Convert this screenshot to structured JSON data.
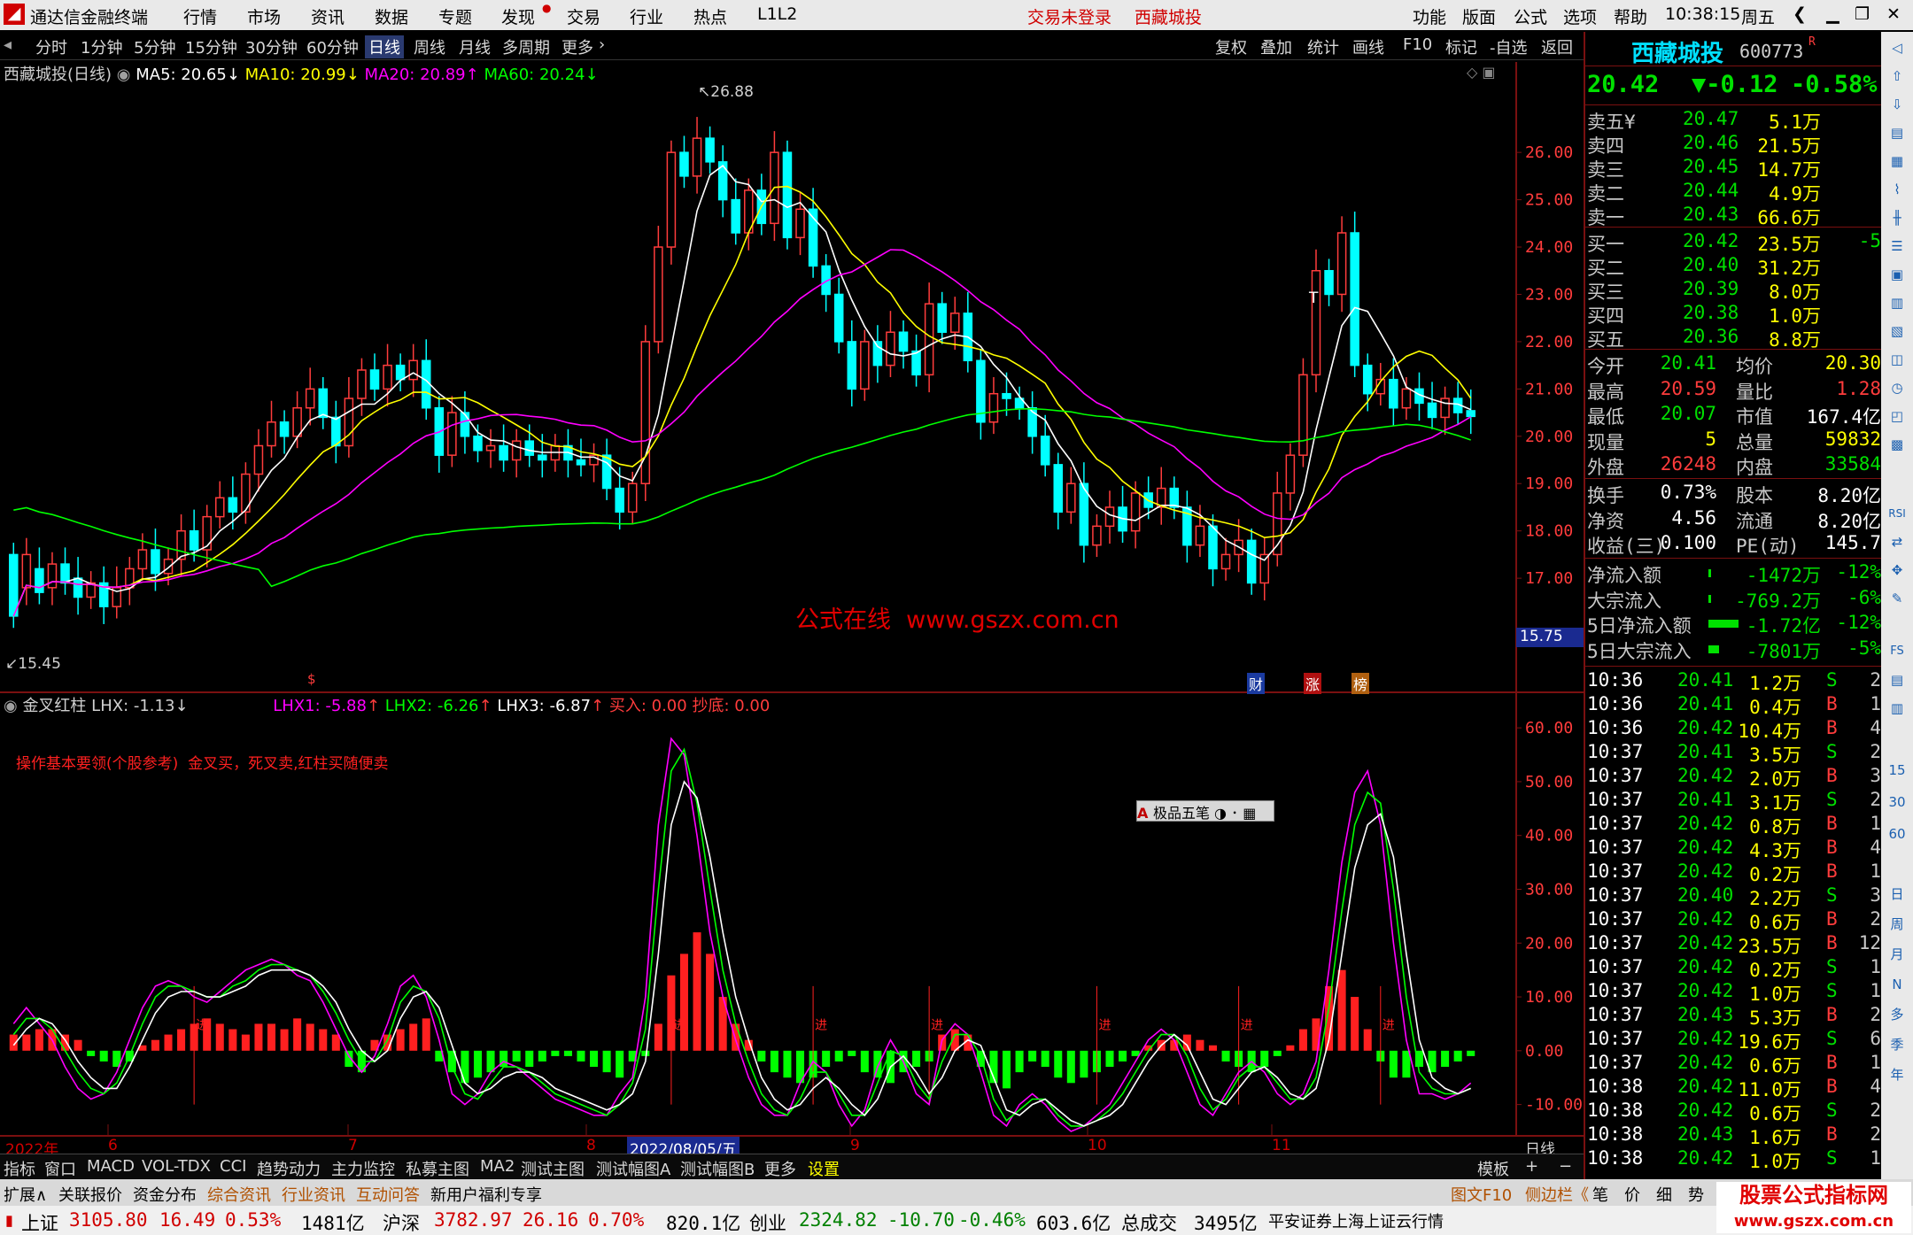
{
  "titlebar": {
    "app_name": "通达信金融终端",
    "menus": [
      "行情",
      "市场",
      "资讯",
      "数据",
      "专题",
      "发现",
      "交易",
      "行业",
      "热点",
      "L1L2"
    ],
    "login_status": "交易未登录",
    "stock_name": "西藏城投",
    "right_menus": [
      "功能",
      "版面",
      "公式",
      "选项",
      "帮助"
    ],
    "time": "10:38:15",
    "weekday": "周五"
  },
  "periodbar": {
    "periods": [
      "分时",
      "1分钟",
      "5分钟",
      "15分钟",
      "30分钟",
      "60分钟",
      "日线",
      "周线",
      "月线",
      "多周期",
      "更多"
    ],
    "selected": "日线",
    "tools": [
      "复权",
      "叠加",
      "统计",
      "画线",
      "F10",
      "标记",
      "-自选",
      "返回"
    ]
  },
  "main_chart": {
    "header_name": "西藏城投(日线)",
    "ma5": "MA5: 20.65",
    "ma10": "MA10: 20.99",
    "ma20": "MA20: 20.89",
    "ma60": "MA60: 20.24",
    "high_label": "26.88",
    "low_label": "15.45",
    "t_mark": "T",
    "watermark": "公式在线  www.gszx.com.cn",
    "price_ticks": [
      "26.00",
      "25.00",
      "24.00",
      "23.00",
      "22.00",
      "21.00",
      "20.00",
      "19.00",
      "18.00",
      "17.00"
    ],
    "cursor_price": "15.75",
    "markers": [
      "财",
      "涨",
      "榜"
    ],
    "dollar_mark": "$",
    "colors": {
      "up": "#ff3c3c",
      "down": "#00ffff",
      "ma5": "#ffffff",
      "ma10": "#ffff00",
      "ma20": "#ff00ff",
      "ma60": "#00ff00"
    }
  },
  "sub_chart": {
    "name": "金叉红柱",
    "lhx": "LHX: -1.13",
    "lhx1": "LHX1: -5.88",
    "lhx2": "LHX2: -6.26",
    "lhx3": "LHX3: -6.87",
    "buy": "买入: 0.00",
    "bottom": "抄底: 0.00",
    "note": "操作基本要领(个股参考)  金叉买，死叉卖,红柱买随便卖",
    "ticks": [
      "60.00",
      "50.00",
      "40.00",
      "30.00",
      "20.00",
      "10.00",
      "0.00",
      "-10.00"
    ],
    "jin": "进",
    "ime": "极品五笔"
  },
  "date_axis": {
    "labels": [
      "2022年",
      "6",
      "7",
      "8",
      "2022/08/05/五",
      "9",
      "10",
      "11"
    ],
    "period": "日线"
  },
  "quote": {
    "name": "西藏城投",
    "code": "600773",
    "r_mark": "R",
    "price": "20.42",
    "change": "▼-0.12",
    "change_pct": "-0.58%",
    "asks": [
      {
        "label": "卖五",
        "price": "20.47",
        "vol": "5.1万",
        "mark": "¥"
      },
      {
        "label": "卖四",
        "price": "20.46",
        "vol": "21.5万",
        "mark": ""
      },
      {
        "label": "卖三",
        "price": "20.45",
        "vol": "14.7万",
        "mark": ""
      },
      {
        "label": "卖二",
        "price": "20.44",
        "vol": "4.9万",
        "mark": ""
      },
      {
        "label": "卖一",
        "price": "20.43",
        "vol": "66.6万",
        "mark": ""
      }
    ],
    "bids": [
      {
        "label": "买一",
        "price": "20.42",
        "vol": "23.5万",
        "mark": "-5"
      },
      {
        "label": "买二",
        "price": "20.40",
        "vol": "31.2万",
        "mark": ""
      },
      {
        "label": "买三",
        "price": "20.39",
        "vol": "8.0万",
        "mark": ""
      },
      {
        "label": "买四",
        "price": "20.38",
        "vol": "1.0万",
        "mark": ""
      },
      {
        "label": "买五",
        "price": "20.36",
        "vol": "8.8万",
        "mark": ""
      }
    ],
    "stats": [
      {
        "l1": "今开",
        "v1": "20.41",
        "l2": "均价",
        "v2": "20.30"
      },
      {
        "l1": "最高",
        "v1": "20.59",
        "l2": "量比",
        "v2": "1.28"
      },
      {
        "l1": "最低",
        "v1": "20.07",
        "l2": "市值",
        "v2": "167.4亿"
      },
      {
        "l1": "现量",
        "v1": "5",
        "l2": "总量",
        "v2": "59832"
      },
      {
        "l1": "外盘",
        "v1": "26248",
        "l2": "内盘",
        "v2": "33584"
      }
    ],
    "stats2": [
      {
        "l1": "换手",
        "v1": "0.73%",
        "l2": "股本",
        "v2": "8.20亿"
      },
      {
        "l1": "净资",
        "v1": "4.56",
        "l2": "流通",
        "v2": "8.20亿"
      },
      {
        "l1": "收益(三)",
        "v1": "0.100",
        "l2": "PE(动)",
        "v2": "145.7"
      }
    ],
    "flows": [
      {
        "label": "净流入额",
        "val": "-1472万",
        "pct": "-12%"
      },
      {
        "label": "大宗流入",
        "val": "-769.2万",
        "pct": "-6%"
      },
      {
        "label": "5日净流入额",
        "val": "-1.72亿",
        "pct": "-12%"
      },
      {
        "label": "5日大宗流入",
        "val": "-7801万",
        "pct": "-5%"
      }
    ],
    "ticks": [
      {
        "t": "10:36",
        "p": "20.41",
        "v": "1.2万",
        "s": "S",
        "n": "2"
      },
      {
        "t": "10:36",
        "p": "20.41",
        "v": "0.4万",
        "s": "B",
        "n": "1"
      },
      {
        "t": "10:36",
        "p": "20.42",
        "v": "10.4万",
        "s": "B",
        "n": "4"
      },
      {
        "t": "10:37",
        "p": "20.41",
        "v": "3.5万",
        "s": "S",
        "n": "2"
      },
      {
        "t": "10:37",
        "p": "20.42",
        "v": "2.0万",
        "s": "B",
        "n": "3"
      },
      {
        "t": "10:37",
        "p": "20.41",
        "v": "3.1万",
        "s": "S",
        "n": "2"
      },
      {
        "t": "10:37",
        "p": "20.42",
        "v": "0.8万",
        "s": "B",
        "n": "1"
      },
      {
        "t": "10:37",
        "p": "20.42",
        "v": "4.3万",
        "s": "B",
        "n": "4"
      },
      {
        "t": "10:37",
        "p": "20.42",
        "v": "0.2万",
        "s": "B",
        "n": "1"
      },
      {
        "t": "10:37",
        "p": "20.40",
        "v": "2.2万",
        "s": "S",
        "n": "3"
      },
      {
        "t": "10:37",
        "p": "20.42",
        "v": "0.6万",
        "s": "B",
        "n": "2"
      },
      {
        "t": "10:37",
        "p": "20.42",
        "v": "23.5万",
        "s": "B",
        "n": "12"
      },
      {
        "t": "10:37",
        "p": "20.42",
        "v": "0.2万",
        "s": "S",
        "n": "1"
      },
      {
        "t": "10:37",
        "p": "20.42",
        "v": "1.0万",
        "s": "S",
        "n": "1"
      },
      {
        "t": "10:37",
        "p": "20.43",
        "v": "5.3万",
        "s": "B",
        "n": "2"
      },
      {
        "t": "10:37",
        "p": "20.42",
        "v": "19.6万",
        "s": "S",
        "n": "6"
      },
      {
        "t": "10:37",
        "p": "20.42",
        "v": "0.6万",
        "s": "B",
        "n": "1"
      },
      {
        "t": "10:38",
        "p": "20.42",
        "v": "11.0万",
        "s": "B",
        "n": "4"
      },
      {
        "t": "10:38",
        "p": "20.42",
        "v": "0.6万",
        "s": "S",
        "n": "2"
      },
      {
        "t": "10:38",
        "p": "20.43",
        "v": "1.6万",
        "s": "B",
        "n": "2"
      },
      {
        "t": "10:38",
        "p": "20.42",
        "v": "1.0万",
        "s": "S",
        "n": "1"
      }
    ]
  },
  "right_icons": [
    "RSI",
    "FS",
    "15",
    "30",
    "60",
    "日",
    "周",
    "月",
    "N",
    "多",
    "季",
    "年"
  ],
  "bottom_tabs": [
    "指标",
    "窗口",
    "MACD",
    "VOL-TDX",
    "CCI",
    "趋势动力",
    "主力监控",
    "私募主图",
    "MA2",
    "测试主图",
    "测试幅图A",
    "测试幅图B",
    "更多",
    "设置",
    "模板"
  ],
  "bottom_bar2": {
    "items": [
      "扩展∧",
      "关联报价",
      "资金分布",
      "综合资讯",
      "行业资讯",
      "互动问答",
      "新用户福利专享"
    ],
    "right_items": [
      "图文F10",
      "侧边栏《",
      "笔",
      "价",
      "细",
      "势"
    ]
  },
  "statusbar": {
    "sh_label": "上证",
    "sh_val": "3105.80",
    "sh_chg": "16.49",
    "sh_pct": "0.53%",
    "sh_amt": "1481亿",
    "hs_label": "沪深",
    "hs_val": "3782.97",
    "hs_chg": "26.16",
    "hs_pct": "0.70%",
    "hs_amt": "820.1亿",
    "cy_label": "创业",
    "cy_val": "2324.82",
    "cy_chg": "-10.70",
    "cy_pct": "-0.46%",
    "cy_amt": "603.6亿",
    "total_label": "总成交",
    "total_val": "3495亿",
    "broker": "平安证券上海上证云行情"
  },
  "logo": {
    "line1": "股票公式指标网",
    "line2": "www.gszx.com.cn"
  },
  "chart_data": {
    "type": "candlestick",
    "ylim": [
      15.0,
      27.5
    ],
    "candles": [
      [
        17.5,
        16.2
      ],
      [
        16.8,
        17.5
      ],
      [
        17.2,
        16.7
      ],
      [
        16.8,
        17.3
      ],
      [
        17.3,
        16.9
      ],
      [
        17.0,
        16.6
      ],
      [
        16.6,
        16.9
      ],
      [
        16.9,
        16.4
      ],
      [
        16.4,
        16.8
      ],
      [
        16.8,
        17.2
      ],
      [
        17.2,
        17.6
      ],
      [
        17.6,
        17.1
      ],
      [
        17.1,
        17.4
      ],
      [
        17.4,
        18.0
      ],
      [
        18.0,
        17.6
      ],
      [
        17.6,
        18.3
      ],
      [
        18.3,
        18.7
      ],
      [
        18.7,
        18.4
      ],
      [
        18.4,
        19.2
      ],
      [
        19.2,
        19.8
      ],
      [
        19.8,
        20.3
      ],
      [
        20.3,
        20.0
      ],
      [
        20.0,
        20.6
      ],
      [
        20.6,
        21.0
      ],
      [
        21.0,
        20.4
      ],
      [
        20.4,
        19.8
      ],
      [
        19.8,
        20.8
      ],
      [
        20.8,
        21.4
      ],
      [
        21.4,
        21.0
      ],
      [
        21.0,
        21.5
      ],
      [
        21.5,
        21.2
      ],
      [
        21.2,
        21.6
      ],
      [
        21.6,
        20.6
      ],
      [
        20.6,
        19.6
      ],
      [
        19.6,
        20.5
      ],
      [
        20.5,
        20.0
      ],
      [
        20.0,
        19.7
      ],
      [
        19.7,
        19.8
      ],
      [
        19.8,
        19.5
      ],
      [
        19.5,
        19.9
      ],
      [
        19.9,
        19.6
      ],
      [
        19.6,
        19.5
      ],
      [
        19.5,
        19.8
      ],
      [
        19.8,
        19.5
      ],
      [
        19.5,
        19.4
      ],
      [
        19.4,
        19.6
      ],
      [
        19.6,
        18.9
      ],
      [
        18.9,
        18.4
      ],
      [
        18.4,
        19.0
      ],
      [
        19.0,
        22.0
      ],
      [
        22.0,
        24.0
      ],
      [
        24.0,
        26.0
      ],
      [
        26.0,
        25.5
      ],
      [
        25.5,
        26.3
      ],
      [
        26.3,
        25.8
      ],
      [
        25.8,
        25.0
      ],
      [
        25.0,
        24.3
      ],
      [
        24.3,
        25.2
      ],
      [
        25.2,
        24.5
      ],
      [
        24.5,
        26.0
      ],
      [
        26.0,
        24.2
      ],
      [
        24.2,
        24.8
      ],
      [
        24.8,
        23.6
      ],
      [
        23.6,
        23.0
      ],
      [
        23.0,
        22.0
      ],
      [
        22.0,
        21.0
      ],
      [
        21.0,
        22.0
      ],
      [
        22.0,
        21.5
      ],
      [
        21.5,
        22.2
      ],
      [
        22.2,
        21.8
      ],
      [
        21.8,
        21.3
      ],
      [
        21.3,
        22.8
      ],
      [
        22.8,
        22.2
      ],
      [
        22.2,
        22.6
      ],
      [
        22.6,
        21.6
      ],
      [
        21.6,
        20.3
      ],
      [
        20.3,
        20.9
      ],
      [
        20.9,
        20.8
      ],
      [
        20.8,
        20.6
      ],
      [
        20.6,
        20.0
      ],
      [
        20.0,
        19.4
      ],
      [
        19.4,
        18.4
      ],
      [
        18.4,
        19.0
      ],
      [
        19.0,
        17.7
      ],
      [
        17.7,
        18.1
      ],
      [
        18.1,
        18.5
      ],
      [
        18.5,
        18.0
      ],
      [
        18.0,
        18.8
      ],
      [
        18.8,
        18.5
      ],
      [
        18.5,
        18.9
      ],
      [
        18.9,
        18.5
      ],
      [
        18.5,
        17.7
      ],
      [
        17.7,
        18.1
      ],
      [
        18.1,
        17.2
      ],
      [
        17.2,
        17.5
      ],
      [
        17.5,
        17.8
      ],
      [
        17.8,
        16.9
      ],
      [
        16.9,
        17.5
      ],
      [
        17.5,
        18.8
      ],
      [
        18.8,
        19.6
      ],
      [
        19.6,
        21.3
      ],
      [
        21.3,
        23.5
      ],
      [
        23.5,
        23.0
      ],
      [
        23.0,
        24.3
      ],
      [
        24.3,
        21.5
      ],
      [
        21.5,
        20.9
      ],
      [
        20.9,
        21.2
      ],
      [
        21.2,
        20.6
      ],
      [
        20.6,
        21.0
      ],
      [
        21.0,
        20.7
      ],
      [
        20.7,
        20.4
      ],
      [
        20.4,
        20.8
      ],
      [
        20.8,
        20.5
      ],
      [
        20.54,
        20.42
      ]
    ],
    "ma5_color": "#ffffff",
    "ma10_color": "#ffff00",
    "ma20_color": "#ff00ff",
    "ma60_color": "#00ff00",
    "indicator_ylim": [
      -15,
      62
    ],
    "indicator_hist": [
      3,
      3,
      4,
      4,
      3,
      2,
      -1,
      -2,
      -3,
      -2,
      1,
      2,
      3,
      4,
      5,
      6,
      5,
      4,
      3,
      5,
      5,
      4,
      6,
      5,
      4,
      3,
      -3,
      -4,
      2,
      3,
      4,
      5,
      6,
      -2,
      -4,
      -6,
      -5,
      -4,
      -3,
      -2,
      -3,
      -2,
      -1,
      -1,
      -2,
      -3,
      -4,
      -5,
      -2,
      -1,
      5,
      14,
      18,
      22,
      18,
      10,
      5,
      2,
      -2,
      -4,
      -5,
      -6,
      -5,
      -3,
      -2,
      -1,
      -4,
      -5,
      -6,
      -4,
      -3,
      -2,
      3,
      4,
      3,
      -3,
      -6,
      -7,
      -4,
      -2,
      -3,
      -5,
      -6,
      -5,
      -4,
      -3,
      -2,
      -1,
      1,
      2,
      2,
      3,
      2,
      1,
      -2,
      -3,
      -4,
      -3,
      -1,
      1,
      4,
      6,
      12,
      15,
      10,
      4,
      -2,
      -5,
      -5,
      -3,
      -4,
      -3,
      -2,
      -1
    ],
    "lhx1": [
      5,
      8,
      5,
      2,
      -3,
      -7,
      -9,
      -8,
      -4,
      2,
      8,
      12,
      13,
      12,
      10,
      9,
      11,
      13,
      15,
      16,
      17,
      16,
      14,
      13,
      9,
      4,
      -1,
      -4,
      -1,
      5,
      12,
      14,
      10,
      2,
      -8,
      -10,
      -8,
      -4,
      -2,
      -3,
      -5,
      -7,
      -9,
      -10,
      -11,
      -12,
      -12,
      -8,
      -5,
      10,
      42,
      58,
      55,
      40,
      22,
      10,
      2,
      -5,
      -10,
      -12,
      -12,
      -6,
      -2,
      -4,
      -10,
      -14,
      -11,
      -3,
      2,
      -2,
      -8,
      -10,
      2,
      5,
      3,
      -4,
      -12,
      -14,
      -10,
      -8,
      -10,
      -13,
      -15,
      -14,
      -12,
      -10,
      -6,
      -2,
      2,
      4,
      2,
      -4,
      -10,
      -12,
      -8,
      -4,
      -2,
      -4,
      -8,
      -10,
      -8,
      -2,
      15,
      35,
      48,
      52,
      42,
      20,
      2,
      -8,
      -8,
      -9,
      -8,
      -6
    ],
    "lhx2": [
      3,
      6,
      6,
      4,
      0,
      -4,
      -7,
      -8,
      -6,
      -1,
      5,
      10,
      12,
      12,
      11,
      10,
      10,
      12,
      13,
      15,
      16,
      16,
      15,
      14,
      11,
      7,
      2,
      -2,
      -2,
      2,
      9,
      12,
      11,
      6,
      -3,
      -8,
      -9,
      -6,
      -3,
      -3,
      -4,
      -6,
      -8,
      -9,
      -10,
      -11,
      -12,
      -10,
      -6,
      4,
      30,
      52,
      56,
      46,
      30,
      15,
      5,
      -2,
      -8,
      -11,
      -12,
      -9,
      -4,
      -4,
      -8,
      -12,
      -12,
      -6,
      0,
      -1,
      -6,
      -9,
      -2,
      3,
      3,
      -1,
      -9,
      -13,
      -11,
      -9,
      -9,
      -12,
      -14,
      -14,
      -13,
      -11,
      -8,
      -4,
      0,
      3,
      3,
      -1,
      -7,
      -11,
      -9,
      -5,
      -3,
      -3,
      -6,
      -9,
      -9,
      -5,
      8,
      26,
      42,
      48,
      46,
      30,
      10,
      -4,
      -7,
      -8,
      -8,
      -7
    ],
    "lhx3": [
      1,
      4,
      6,
      5,
      2,
      -2,
      -5,
      -7,
      -7,
      -3,
      2,
      7,
      10,
      11,
      11,
      10,
      10,
      11,
      12,
      14,
      15,
      15,
      15,
      14,
      12,
      9,
      4,
      0,
      -2,
      0,
      6,
      10,
      11,
      8,
      1,
      -6,
      -8,
      -7,
      -5,
      -4,
      -4,
      -5,
      -7,
      -8,
      -9,
      -10,
      -11,
      -10,
      -8,
      -2,
      18,
      42,
      50,
      47,
      36,
      22,
      10,
      2,
      -5,
      -9,
      -11,
      -10,
      -7,
      -5,
      -7,
      -10,
      -12,
      -9,
      -3,
      -1,
      -4,
      -8,
      -5,
      0,
      2,
      1,
      -5,
      -11,
      -12,
      -10,
      -9,
      -11,
      -13,
      -14,
      -13,
      -12,
      -10,
      -6,
      -2,
      1,
      3,
      1,
      -4,
      -9,
      -10,
      -7,
      -4,
      -3,
      -5,
      -8,
      -9,
      -7,
      2,
      18,
      34,
      42,
      44,
      36,
      18,
      2,
      -5,
      -7,
      -8,
      -7
    ],
    "jin_positions": [
      14,
      51,
      62,
      71,
      84,
      95,
      106
    ]
  }
}
